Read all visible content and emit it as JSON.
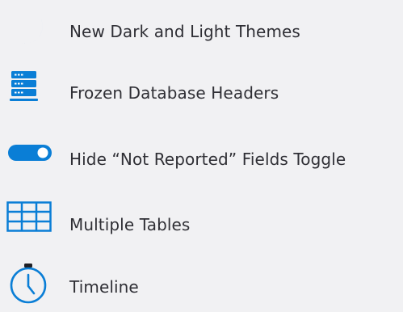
{
  "accent_color": "#0a7ed6",
  "features": [
    {
      "label": "New Dark and Light Themes",
      "icon": "crescent-moon-icon"
    },
    {
      "label": "Frozen Database Headers",
      "icon": "server-stack-icon"
    },
    {
      "label": "Hide “Not Reported” Fields Toggle",
      "icon": "toggle-switch-icon"
    },
    {
      "label": "Multiple Tables",
      "icon": "table-grid-icon"
    },
    {
      "label": "Timeline",
      "icon": "stopwatch-icon"
    }
  ]
}
